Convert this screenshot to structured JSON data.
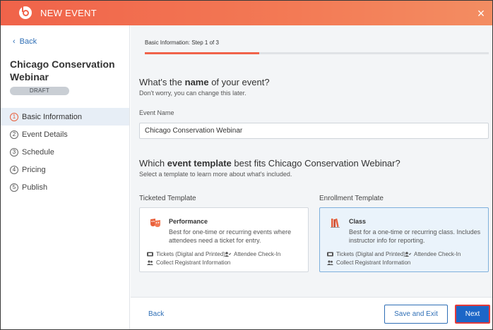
{
  "header": {
    "title": "NEW EVENT",
    "close_glyph": "×",
    "accent_color": "#f0634a"
  },
  "sidebar": {
    "back_label": "Back",
    "event_title": "Chicago Conservation Webinar",
    "status_badge": "DRAFT",
    "steps": [
      {
        "num": "1",
        "label": "Basic Information",
        "active": true
      },
      {
        "num": "2",
        "label": "Event Details",
        "active": false
      },
      {
        "num": "3",
        "label": "Schedule",
        "active": false
      },
      {
        "num": "4",
        "label": "Pricing",
        "active": false
      },
      {
        "num": "5",
        "label": "Publish",
        "active": false
      }
    ]
  },
  "main": {
    "step_label": "Basic Information: Step 1 of 3",
    "progress_fraction": 0.333,
    "name_question_pre": "What's the ",
    "name_question_bold": "name",
    "name_question_post": " of your event?",
    "name_hint": "Don't worry, you can change this later.",
    "event_name_label": "Event Name",
    "event_name_value": "Chicago Conservation Webinar",
    "template_question_pre": "Which ",
    "template_question_bold": "event template",
    "template_question_post": " best fits Chicago Conservation Webinar?",
    "template_hint": "Select a template to learn more about what's included.",
    "ticketed": {
      "column_label": "Ticketed Template",
      "title": "Performance",
      "description": "Best for one-time or recurring events where attendees need a ticket for entry.",
      "features": [
        "Tickets (Digital and Printed)",
        "Attendee Check-In",
        "Collect Registrant Information"
      ],
      "icon": "theater-masks-icon"
    },
    "enrollment": {
      "column_label": "Enrollment Template",
      "title": "Class",
      "description": "Best for a one-time or recurring class. Includes instructor info for reporting.",
      "features": [
        "Tickets (Digital and Printed)",
        "Attendee Check-In",
        "Collect Registrant Information"
      ],
      "icon": "books-icon",
      "selected": true
    }
  },
  "footer": {
    "back_label": "Back",
    "save_label": "Save and Exit",
    "next_label": "Next"
  }
}
